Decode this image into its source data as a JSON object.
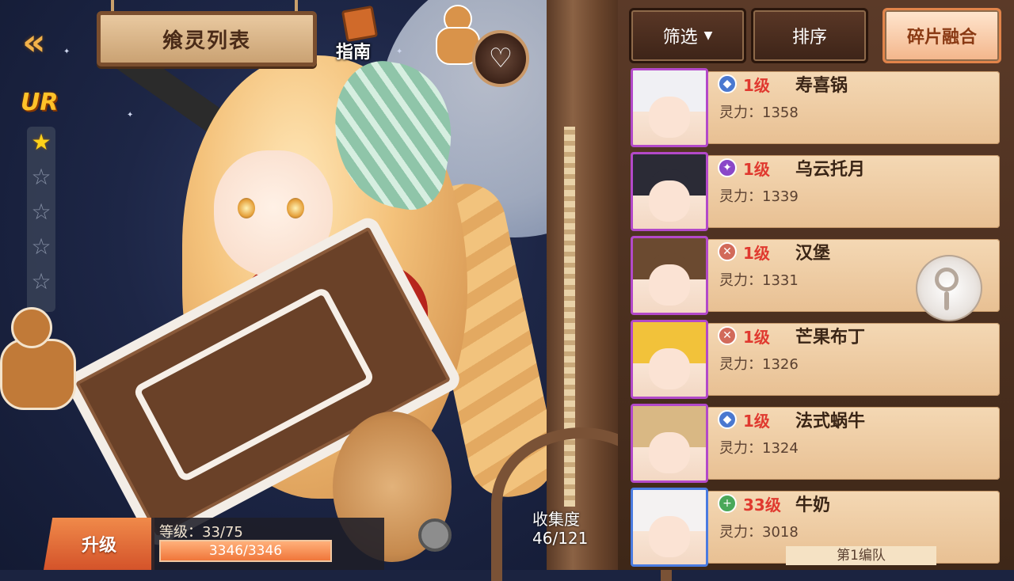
{
  "header": {
    "title": "飨灵列表",
    "guide_label": "指南",
    "back_glyph": "«",
    "fav_glyph": "♡"
  },
  "rarity": {
    "label": "UR",
    "stars_total": 5,
    "stars_filled": 1
  },
  "level": {
    "upgrade_label": "升级",
    "level_text": "等级：33/75",
    "exp_current": 3346,
    "exp_max": 3346,
    "exp_text": "3346/3346"
  },
  "collection": {
    "label": "收集度",
    "value": "46/121"
  },
  "toolbar": {
    "filter_label": "筛选",
    "sort_label": "排序",
    "fuse_label": "碎片融合"
  },
  "list": [
    {
      "level": "1级",
      "name": "寿喜锅",
      "power": "灵力：1358",
      "role": "shield",
      "role_color": "#4a78d0",
      "frame": "purple",
      "hair_color": "#f0f0f4"
    },
    {
      "level": "1级",
      "name": "乌云托月",
      "power": "灵力：1339",
      "role": "magic",
      "role_color": "#8a47c8",
      "frame": "purple",
      "hair_color": "#2b2b36"
    },
    {
      "level": "1级",
      "name": "汉堡",
      "power": "灵力：1331",
      "role": "sword",
      "role_color": "#d26a5a",
      "frame": "purple",
      "hair_color": "#6b4a30"
    },
    {
      "level": "1级",
      "name": "芒果布丁",
      "power": "灵力：1326",
      "role": "sword",
      "role_color": "#d26a5a",
      "frame": "purple",
      "hair_color": "#f2c23a"
    },
    {
      "level": "1级",
      "name": "法式蜗牛",
      "power": "灵力：1324",
      "role": "shield",
      "role_color": "#4a78d0",
      "frame": "purple",
      "hair_color": "#d9b884"
    },
    {
      "level": "33级",
      "name": "牛奶",
      "power": "灵力：3018",
      "role": "heal",
      "role_color": "#4aa85a",
      "frame": "blue",
      "hair_color": "#f4f2f2",
      "team_tag": "第1编队"
    }
  ],
  "colors": {
    "accent": "#f08a4a",
    "level_red": "#e0392f",
    "star_gold": "#ffd21a"
  }
}
